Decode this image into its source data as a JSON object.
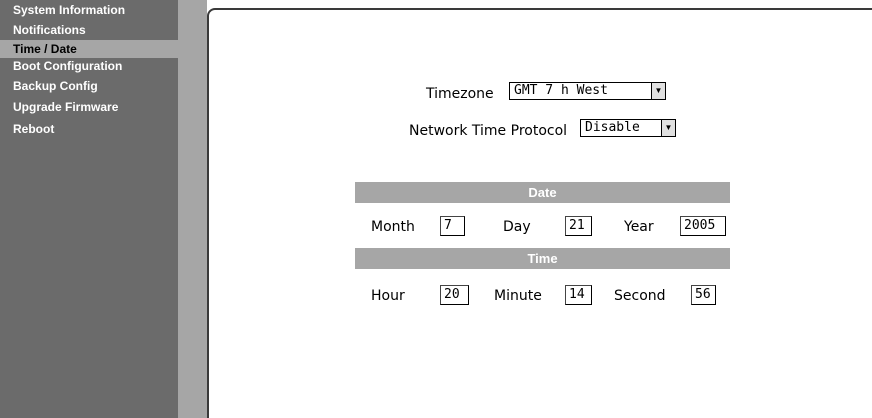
{
  "sidebar": {
    "items": [
      {
        "label": "System Information"
      },
      {
        "label": "Notifications"
      },
      {
        "label": "Time / Date"
      },
      {
        "label": "Boot Configuration"
      },
      {
        "label": "Backup Config"
      },
      {
        "label": "Upgrade Firmware"
      },
      {
        "label": "Reboot"
      }
    ],
    "active": "Time / Date"
  },
  "form": {
    "timezone_label": "Timezone",
    "timezone_value": "GMT 7 h West",
    "ntp_label": "Network Time Protocol",
    "ntp_value": "Disable",
    "date_header": "Date",
    "month_label": "Month",
    "month_value": "7",
    "day_label": "Day",
    "day_value": "21",
    "year_label": "Year",
    "year_value": "2005",
    "time_header": "Time",
    "hour_label": "Hour",
    "hour_value": "20",
    "minute_label": "Minute",
    "minute_value": "14",
    "second_label": "Second",
    "second_value": "56"
  },
  "icons": {
    "dropdown": "chevron-down-icon"
  },
  "colors": {
    "sidebar": "#6b6b6b",
    "gutter": "#a6a6a6",
    "band": "#a6a6a6"
  }
}
